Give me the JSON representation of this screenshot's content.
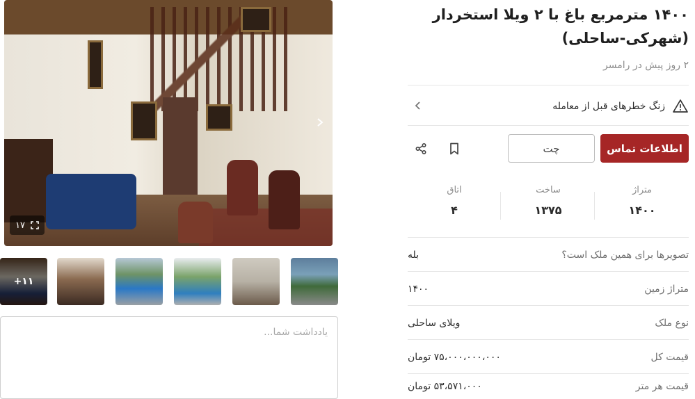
{
  "listing": {
    "title": "۱۴۰۰ مترمربع باغ با ۲ ویلا استخردار (شهرکی-ساحلی)",
    "subtitle": "۲ روز پیش در رامسر",
    "warning": "زنگ خطرهای قبل از معامله",
    "contact_label": "اطلاعات تماس",
    "chat_label": "چت"
  },
  "stats": [
    {
      "label": "متراژ",
      "value": "۱۴۰۰"
    },
    {
      "label": "ساخت",
      "value": "۱۳۷۵"
    },
    {
      "label": "اتاق",
      "value": "۴"
    }
  ],
  "details": [
    {
      "key": "تصویرها برای همین ملک است؟",
      "value": "بله"
    },
    {
      "key": "متراژ زمین",
      "value": "۱۴۰۰"
    },
    {
      "key": "نوع ملک",
      "value": "ویلای ساحلی"
    },
    {
      "key": "قیمت کل",
      "value": "۷۵،۰۰۰،۰۰۰،۰۰۰ تومان"
    },
    {
      "key": "قیمت هر متر",
      "value": "۵۳،۵۷۱،۰۰۰ تومان"
    }
  ],
  "gallery": {
    "photo_count": "۱۷",
    "more_count": "+۱۱"
  },
  "note": {
    "placeholder": "یادداشت شما..."
  },
  "colors": {
    "primary": "#a62626",
    "muted_text": "#8c8c8c",
    "divider": "#e6e6e6"
  },
  "icons": {
    "next": "chevron-right-icon",
    "fullscreen": "fullscreen-icon",
    "warning": "warning-triangle-icon",
    "bookmark": "bookmark-icon",
    "share": "share-icon"
  }
}
